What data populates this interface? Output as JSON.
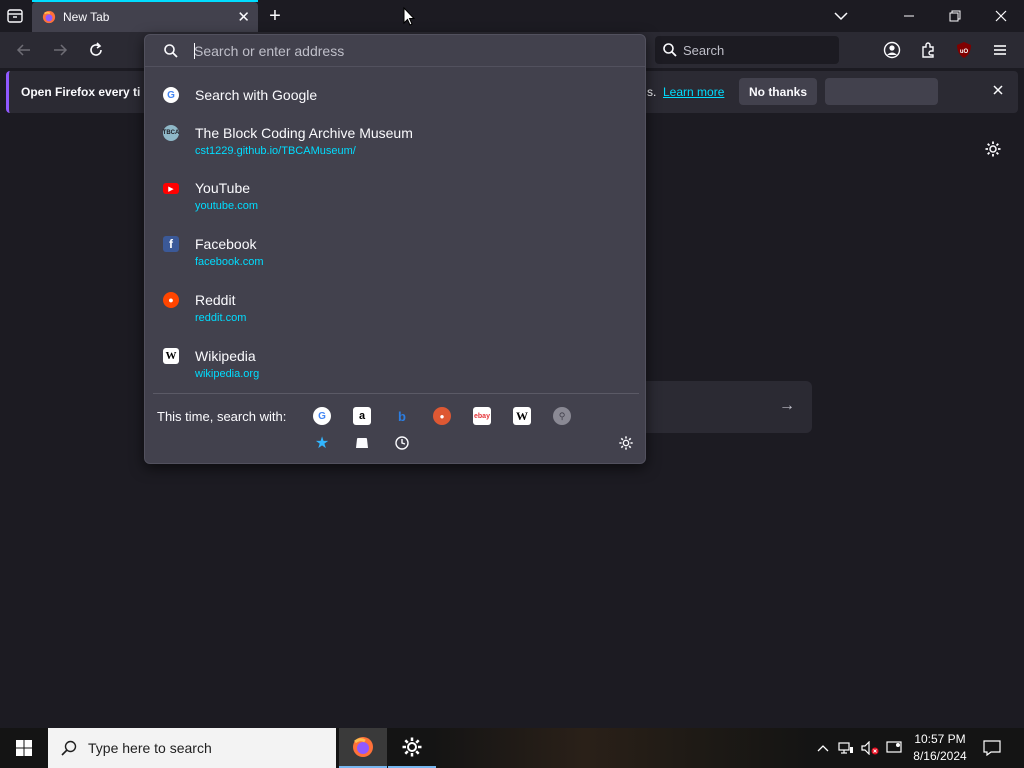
{
  "tab": {
    "title": "New Tab",
    "accent": "#00ddff"
  },
  "toolbar": {
    "search_label": "Search"
  },
  "notification": {
    "message": "Open Firefox every ti",
    "trail": "s.",
    "learn_more": "Learn more",
    "no_thanks": "No thanks"
  },
  "urlbar": {
    "placeholder": "Search or enter address",
    "results": [
      {
        "title": "Search with Google",
        "url": ""
      },
      {
        "title": "The Block Coding Archive Museum",
        "url": "cst1229.github.io/TBCAMuseum/"
      },
      {
        "title": "YouTube",
        "url": "youtube.com"
      },
      {
        "title": "Facebook",
        "url": "facebook.com"
      },
      {
        "title": "Reddit",
        "url": "reddit.com"
      },
      {
        "title": "Wikipedia",
        "url": "wikipedia.org"
      }
    ],
    "search_with_label": "This time, search with:",
    "engines": [
      "google-icon",
      "amazon-icon",
      "bing-icon",
      "duckduckgo-icon",
      "ebay-icon",
      "wikipedia-icon",
      "search-engine-icon",
      "bookmarks-star-icon",
      "tabs-icon",
      "history-icon"
    ]
  },
  "taskbar": {
    "search_placeholder": "Type here to search",
    "time": "10:57 PM",
    "date": "8/16/2024"
  }
}
